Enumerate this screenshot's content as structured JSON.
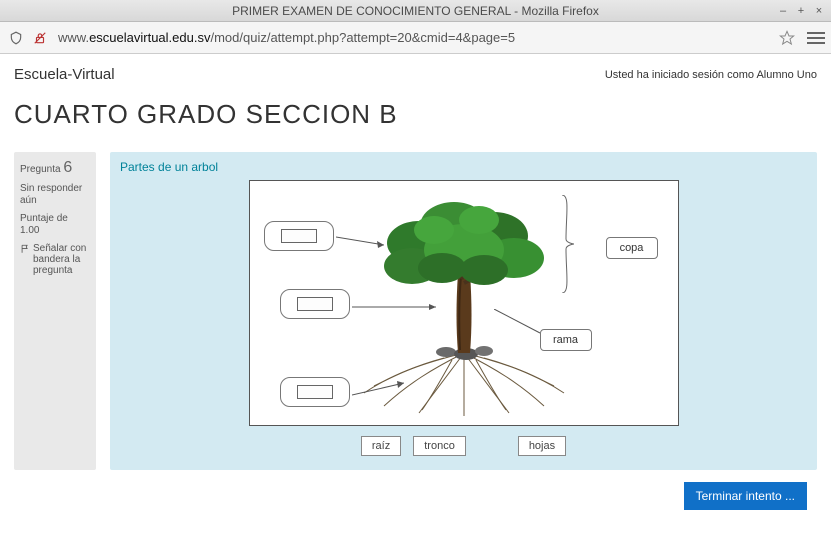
{
  "window": {
    "title": "PRIMER EXAMEN DE CONOCIMIENTO GENERAL - Mozilla Firefox"
  },
  "browser": {
    "url_prefix": "www.",
    "url_domain": "escuelavirtual.edu.sv",
    "url_path": "/mod/quiz/attempt.php?attempt=20&cmid=4&page=5"
  },
  "site": {
    "name": "Escuela-Virtual",
    "login_status": "Usted ha iniciado sesión como Alumno Uno"
  },
  "page_title": "CUARTO GRADO SECCION B",
  "question": {
    "label": "Pregunta",
    "number": "6",
    "state": "Sin responder aún",
    "points": "Puntaje de 1.00",
    "flag": "Señalar con bandera la pregunta",
    "text": "Partes de un arbol"
  },
  "labels": {
    "placed": {
      "copa": "copa",
      "rama": "rama"
    }
  },
  "word_bank": {
    "w1": "raíz",
    "w2": "tronco",
    "w3": "hojas"
  },
  "buttons": {
    "finish": "Terminar intento ..."
  }
}
